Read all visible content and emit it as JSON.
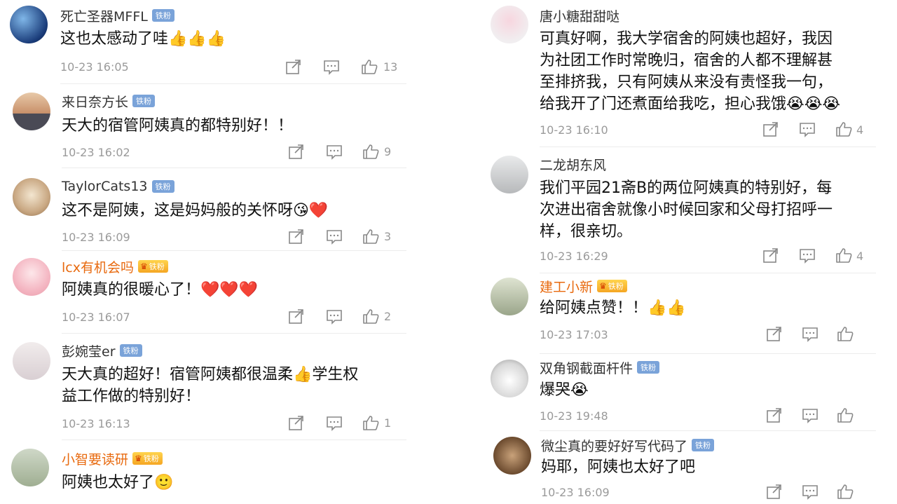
{
  "left": [
    {
      "name": "死亡圣器MFFL",
      "gold": false,
      "badge": "铁粉",
      "text": "这也太感动了哇👍👍👍",
      "time": "10-23 16:05",
      "likes": "13"
    },
    {
      "name": "来日奈方长",
      "gold": false,
      "badge": "铁粉",
      "text": "天大的宿管阿姨真的都特别好！！",
      "time": "10-23 16:02",
      "likes": "9"
    },
    {
      "name": "TaylorCats13",
      "gold": false,
      "badge": "铁粉",
      "text": "这不是阿姨，这是妈妈般的关怀呀😘❤️",
      "time": "10-23 16:09",
      "likes": "3"
    },
    {
      "name": "lcx有机会吗",
      "gold": true,
      "badge": "铁粉",
      "text": "阿姨真的很暖心了！❤️❤️❤️",
      "time": "10-23 16:07",
      "likes": "2"
    },
    {
      "name": "彭婉莹er",
      "gold": false,
      "badge": "铁粉",
      "text_line1": "天大真的超好！宿管阿姨都很温柔👍学生权",
      "text_line2": "益工作做的特别好！",
      "time": "10-23 16:13",
      "likes": "1"
    },
    {
      "name": "小智要读研",
      "gold": true,
      "badge": "铁粉",
      "text": "阿姨也太好了🙂"
    }
  ],
  "right": [
    {
      "name": "唐小糖甜甜哒",
      "gold": false,
      "text_lines": [
        "可真好啊，我大学宿舍的阿姨也超好，我因",
        "为社团工作时常晚归，宿舍的人都不理解甚",
        "至排挤我，只有阿姨从来没有责怪我一句，",
        "给我开了门还煮面给我吃，担心我饿😭😭😭"
      ],
      "time": "10-23 16:10",
      "likes": "4"
    },
    {
      "name": "二龙胡东风",
      "gold": false,
      "text_lines": [
        "我们平园21斋B的两位阿姨真的特别好，每",
        "次进出宿舍就像小时候回家和父母打招呼一",
        "样，很亲切。"
      ],
      "time": "10-23 16:29",
      "likes": "4"
    },
    {
      "name": "建工小新",
      "gold": true,
      "badge": "铁粉",
      "text": "给阿姨点赞！！👍👍",
      "time": "10-23 17:03",
      "likes": ""
    },
    {
      "name": "双角钢截面杆件",
      "gold": false,
      "badge": "铁粉",
      "text": "爆哭😭",
      "time": "10-23 19:48",
      "likes": ""
    },
    {
      "name": "微尘真的要好好写代码了",
      "gold": false,
      "badge": "铁粉",
      "text": "妈耶，阿姨也太好了吧",
      "time": "10-23 16:09",
      "likes": ""
    }
  ],
  "icons": {
    "share": "share-icon",
    "comment": "comment-icon",
    "like": "thumbs-up-icon"
  },
  "colors": {
    "badge_blue": "#7aa3d9",
    "gold_name": "#e86a0f",
    "meta_gray": "#9a9a9a"
  }
}
